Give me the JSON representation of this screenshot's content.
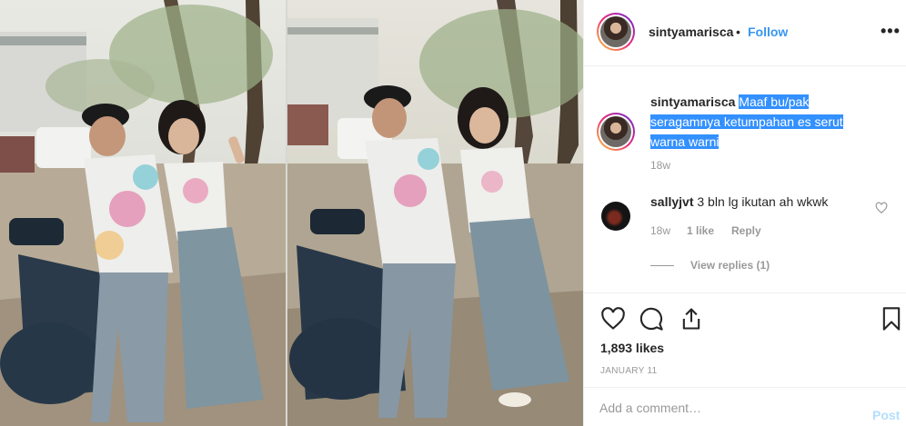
{
  "post": {
    "username": "sintyamarisca",
    "separator": "•",
    "follow_label": "Follow",
    "more_label": "•••",
    "icon_more": "more-dots-icon"
  },
  "caption": {
    "username": "sintyamarisca",
    "line1": "Maaf bu/pak",
    "line2": "seragamnya ketumpahan es serut",
    "line3": "warna warni",
    "time": "18w",
    "selection_color": "#3390ff"
  },
  "comment": {
    "username": "sallyjvt",
    "text": "3 bln lg ikutan ah wkwk",
    "time": "18w",
    "likes": "1 like",
    "reply_label": "Reply",
    "view_replies": "View replies (1)",
    "icon_like": "heart-outline-icon"
  },
  "actions": {
    "icons": [
      "heart-outline-icon",
      "comment-bubble-icon",
      "share-icon",
      "bookmark-icon"
    ],
    "likes": "1,893 likes",
    "date": "JANUARY 11"
  },
  "add_comment": {
    "placeholder": "Add a comment…",
    "post_label": "Post",
    "post_color": "#b2dffc"
  },
  "colors": {
    "link": "#3897f0",
    "text": "#262626",
    "muted": "#999999",
    "border": "#efefef"
  }
}
